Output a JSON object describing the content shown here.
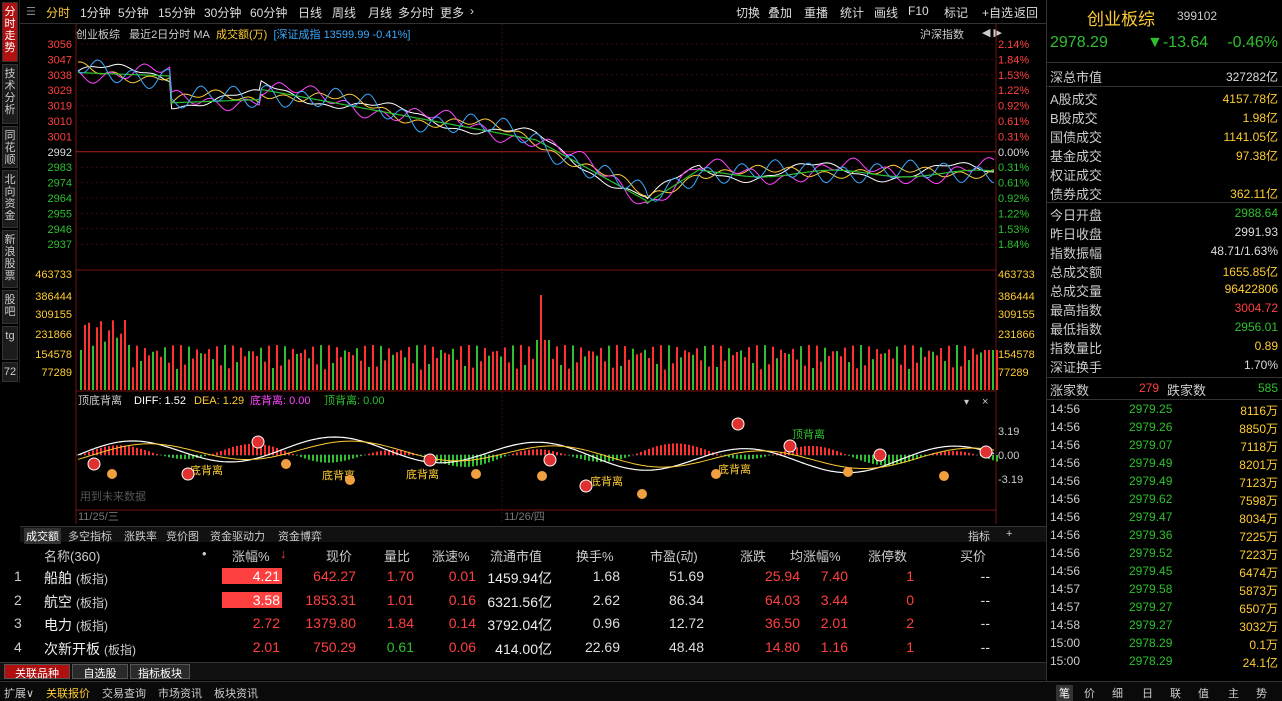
{
  "left_tabs": [
    "分时走势",
    "技术分析",
    "同花顺",
    "北向资金",
    "新浪股票",
    "股吧",
    "tg",
    "72"
  ],
  "toolbar": {
    "tabs": [
      "分时",
      "1分钟",
      "5分钟",
      "15分钟",
      "30分钟",
      "60分钟",
      "日线",
      "周线",
      "月线",
      "多分时",
      "更多"
    ],
    "more_arrow": "›",
    "right": [
      "切换",
      "叠加",
      "重播",
      "统计",
      "画线",
      "F10",
      "标记",
      "+自选",
      "返回"
    ]
  },
  "chart": {
    "header": {
      "name": "创业板综",
      "mode": "最近2日分时 MA",
      "vol_label": "成交额(万)",
      "index_label": "[深证成指",
      "index_value": "13599.99",
      "index_change": "-0.41%]",
      "right": "沪深指数"
    },
    "price_levels": [
      "3056",
      "3047",
      "3038",
      "3029",
      "3019",
      "3010",
      "3001",
      "2992",
      "2983",
      "2974",
      "2964",
      "2955",
      "2946",
      "2937"
    ],
    "pct_levels": [
      "2.14%",
      "1.84%",
      "1.53%",
      "1.22%",
      "0.92%",
      "0.61%",
      "0.31%",
      "0.00%",
      "0.31%",
      "0.61%",
      "0.92%",
      "1.22%",
      "1.53%",
      "1.84%"
    ],
    "vol_levels": [
      "463733",
      "386444",
      "309155",
      "231866",
      "154578",
      "77289"
    ],
    "macd": {
      "title": "顶底背离",
      "diff": "DIFF: 1.52",
      "dea": "DEA: 1.29",
      "bottom": "底背离: 0.00",
      "top": "顶背离: 0.00",
      "levels": [
        "3.19",
        "0.00",
        "-3.19"
      ],
      "labels": [
        "顶背离",
        "底背离",
        "底背离",
        "底背离",
        "底背离",
        "底背离"
      ],
      "watermark": "用到未来数据"
    },
    "dates": [
      "11/25/三",
      "11/26/四"
    ]
  },
  "subtabs": [
    "成交额",
    "多空指标",
    "涨跌率",
    "竞价图",
    "资金驱动力",
    "资金博弈"
  ],
  "subtabs_right": [
    "指标",
    "+"
  ],
  "table": {
    "headers": [
      "名称(360)",
      "涨幅%",
      "现价",
      "量比",
      "涨速%",
      "流通市值",
      "换手%",
      "市盈(动)",
      "涨跌",
      "均涨幅%",
      "涨停数",
      "买价"
    ],
    "rows": [
      {
        "idx": "1",
        "name": "船舶",
        "tag": "(板指)",
        "chg": "4.21",
        "price": "642.27",
        "vr": "1.70",
        "speed": "0.01",
        "cap": "1459.94亿",
        "turn": "1.68",
        "pe": "51.69",
        "diff": "25.94",
        "avg": "7.40",
        "limit": "1",
        "bid": "--"
      },
      {
        "idx": "2",
        "name": "航空",
        "tag": "(板指)",
        "chg": "3.58",
        "price": "1853.31",
        "vr": "1.01",
        "speed": "0.16",
        "cap": "6321.56亿",
        "turn": "2.62",
        "pe": "86.34",
        "diff": "64.03",
        "avg": "3.44",
        "limit": "0",
        "bid": "--"
      },
      {
        "idx": "3",
        "name": "电力",
        "tag": "(板指)",
        "chg": "2.72",
        "price": "1379.80",
        "vr": "1.84",
        "speed": "0.14",
        "cap": "3792.04亿",
        "turn": "0.96",
        "pe": "12.72",
        "diff": "36.50",
        "avg": "2.01",
        "limit": "2",
        "bid": "--"
      },
      {
        "idx": "4",
        "name": "次新开板",
        "tag": "(板指)",
        "chg": "2.01",
        "price": "750.29",
        "vr": "0.61",
        "speed": "0.06",
        "cap": "414.00亿",
        "turn": "22.69",
        "pe": "48.48",
        "diff": "14.80",
        "avg": "1.16",
        "limit": "1",
        "bid": "--"
      }
    ]
  },
  "bottom_tabs": [
    "关联品种",
    "自选股",
    "指标板块"
  ],
  "status_tabs": [
    "扩展∨",
    "关联报价",
    "交易查询",
    "市场资讯",
    "板块资讯"
  ],
  "right_panel": {
    "title": "创业板综",
    "code": "399102",
    "price": "2978.29",
    "change": "▼-13.64",
    "pct": "-0.46%",
    "market": [
      {
        "k": "深总市值",
        "v": "327282亿"
      }
    ],
    "vols": [
      {
        "k": "A股成交",
        "v": "4157.78亿"
      },
      {
        "k": "B股成交",
        "v": "1.98亿"
      },
      {
        "k": "国债成交",
        "v": "1141.05亿"
      },
      {
        "k": "基金成交",
        "v": "97.38亿"
      },
      {
        "k": "权证成交",
        "v": ""
      },
      {
        "k": "债券成交",
        "v": "362.11亿"
      }
    ],
    "stats": [
      {
        "k": "今日开盘",
        "v": "2988.64",
        "c": "green"
      },
      {
        "k": "昨日收盘",
        "v": "2991.93",
        "c": "white"
      },
      {
        "k": "指数振幅",
        "v": "48.71/1.63%",
        "c": "white"
      },
      {
        "k": "总成交额",
        "v": "1655.85亿",
        "c": "yellow"
      },
      {
        "k": "总成交量",
        "v": "96422806",
        "c": "yellow"
      },
      {
        "k": "最高指数",
        "v": "3004.72",
        "c": "red"
      },
      {
        "k": "最低指数",
        "v": "2956.01",
        "c": "green"
      },
      {
        "k": "指数量比",
        "v": "0.89",
        "c": "yellow"
      },
      {
        "k": "深证换手",
        "v": "1.70%",
        "c": "white"
      }
    ],
    "up_label": "涨家数",
    "up": "279",
    "down_label": "跌家数",
    "down": "585",
    "ticks": [
      [
        "14:56",
        "2979.25",
        "8116万"
      ],
      [
        "14:56",
        "2979.26",
        "8850万"
      ],
      [
        "14:56",
        "2979.07",
        "7118万"
      ],
      [
        "14:56",
        "2979.49",
        "8201万"
      ],
      [
        "14:56",
        "2979.49",
        "7123万"
      ],
      [
        "14:56",
        "2979.62",
        "7598万"
      ],
      [
        "14:56",
        "2979.47",
        "8034万"
      ],
      [
        "14:56",
        "2979.36",
        "7225万"
      ],
      [
        "14:56",
        "2979.52",
        "7223万"
      ],
      [
        "14:56",
        "2979.45",
        "6474万"
      ],
      [
        "14:57",
        "2979.58",
        "5873万"
      ],
      [
        "14:57",
        "2979.27",
        "6507万"
      ],
      [
        "14:58",
        "2979.27",
        "3032万"
      ],
      [
        "15:00",
        "2978.29",
        "0.1万"
      ],
      [
        "15:00",
        "2978.29",
        "24.1亿"
      ]
    ],
    "footer": [
      "笔",
      "价",
      "细",
      "日",
      "联",
      "值",
      "主",
      "势"
    ]
  }
}
